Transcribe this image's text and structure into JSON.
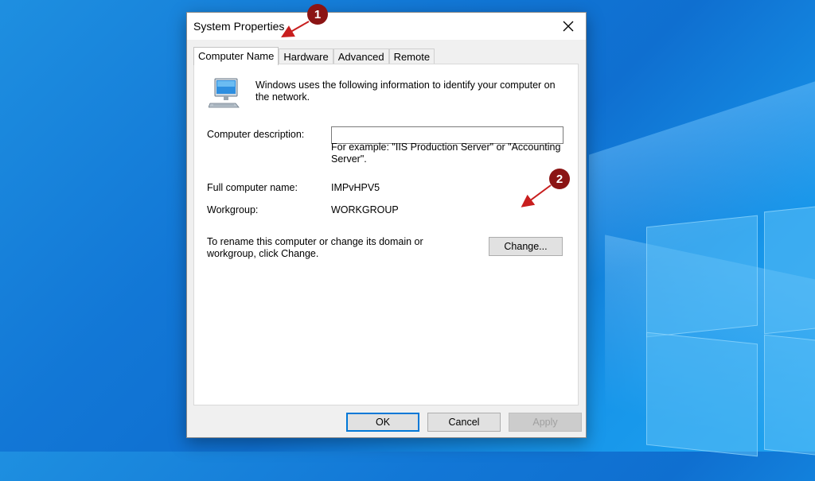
{
  "window": {
    "title": "System Properties"
  },
  "tabs": [
    {
      "label": "Computer Name",
      "active": true
    },
    {
      "label": "Hardware",
      "active": false
    },
    {
      "label": "Advanced",
      "active": false
    },
    {
      "label": "Remote",
      "active": false
    }
  ],
  "computer_name": {
    "intro": "Windows uses the following information to identify your computer on the network.",
    "description_label": "Computer description:",
    "description_value": "",
    "example": "For example: \"IIS Production Server\" or \"Accounting Server\".",
    "full_name_label": "Full computer name:",
    "full_name_value": "IMPvHPV5",
    "workgroup_label": "Workgroup:",
    "workgroup_value": "WORKGROUP",
    "rename_text": "To rename this computer or change its domain or workgroup, click Change.",
    "change_button": "Change..."
  },
  "footer": {
    "ok": "OK",
    "cancel": "Cancel",
    "apply": "Apply"
  },
  "annotations": [
    {
      "label": "1"
    },
    {
      "label": "2"
    }
  ],
  "colors": {
    "annotation": "#8b1414",
    "accent": "#0078d7",
    "desktop": "#1277d6"
  },
  "icons": {
    "close": "close-icon",
    "computer": "computer-monitor-icon"
  }
}
